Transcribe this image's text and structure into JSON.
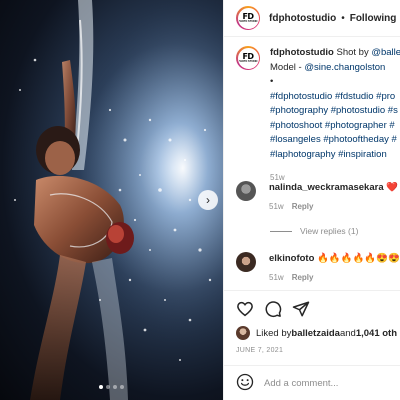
{
  "post": {
    "account": "fdphotostudio",
    "avatar_text_big": "FD",
    "avatar_text_small": "PHOTO STUDIO",
    "separator": "•",
    "follow_label": "Following",
    "caption_lines": [
      {
        "prefix_user": "fdphotostudio",
        "text": " Shot by ",
        "mention": "@ballet"
      },
      {
        "text": "Model - ",
        "mention": "@sine.changolston"
      },
      {
        "text": "•"
      },
      {
        "tags": "#fdphotostudio #fdstudio #pro"
      },
      {
        "tags": "#photography #photostudio #s"
      },
      {
        "tags": "#photoshoot #photographer #"
      },
      {
        "tags": "#losangeles #photooftheday #"
      },
      {
        "tags": "#laphotography #inspiration"
      }
    ],
    "caption_time": "51w"
  },
  "comments": [
    {
      "user": "nalinda_weckramasekara",
      "text": "❤️",
      "time": "51w",
      "reply_label": "Reply",
      "view_replies": "View replies (1)"
    },
    {
      "user": "elkinofoto",
      "text": "🔥🔥🔥🔥🔥😍😍😍",
      "time": "51w",
      "reply_label": "Reply"
    }
  ],
  "likes": {
    "prefix": "Liked by ",
    "user": "balletzaida",
    "middle": " and ",
    "count": "1,041 oth"
  },
  "date": "JUNE 7, 2021",
  "add_comment": {
    "placeholder": "Add a comment..."
  },
  "carousel": {
    "dots": 4,
    "active": 0,
    "next_glyph": "›"
  },
  "icons": {
    "like": "heart-icon",
    "comment": "comment-icon",
    "share": "share-icon",
    "emoji": "emoji-icon",
    "next": "chevron-right-icon"
  },
  "colors": {
    "link": "#00376b",
    "muted": "#8e8e8e",
    "heart": "#ed4956",
    "divider": "#efefef"
  }
}
